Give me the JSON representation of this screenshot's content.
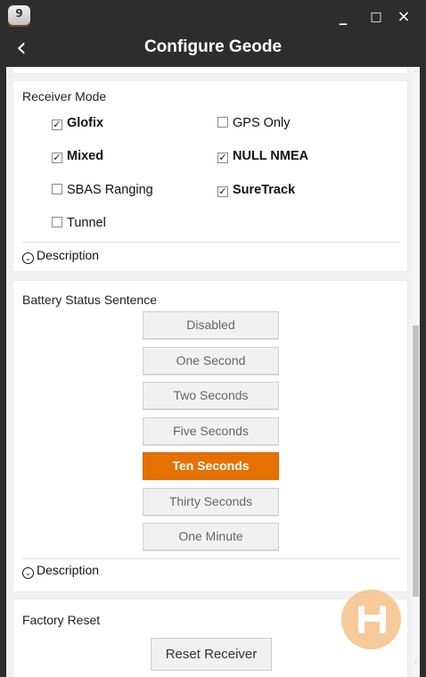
{
  "window": {
    "icon_number": "9",
    "title": "Configure Geode",
    "controls": {
      "minimize": "_",
      "maximize": "□",
      "close": "×",
      "back": "‹"
    }
  },
  "receiver_mode": {
    "title": "Receiver Mode",
    "options": [
      {
        "label": "Glofix",
        "checked": true
      },
      {
        "label": "GPS Only",
        "checked": false
      },
      {
        "label": "Mixed",
        "checked": true
      },
      {
        "label": "NULL NMEA",
        "checked": true
      },
      {
        "label": "SBAS Ranging",
        "checked": false
      },
      {
        "label": "SureTrack",
        "checked": true
      },
      {
        "label": "Tunnel",
        "checked": false
      }
    ],
    "description": "Description"
  },
  "battery_status": {
    "title": "Battery Status Sentence",
    "options": [
      "Disabled",
      "One Second",
      "Two Seconds",
      "Five Seconds",
      "Ten Seconds",
      "Thirty Seconds",
      "One Minute"
    ],
    "selected": "Ten Seconds",
    "description": "Description"
  },
  "factory_reset": {
    "title": "Factory Reset",
    "button": "Reset Receiver"
  },
  "icons": {
    "description": "chevron-circle-icon",
    "save": "floppy-disk-icon"
  },
  "colors": {
    "accent": "#e57200",
    "floating_button": "#f6c894"
  }
}
